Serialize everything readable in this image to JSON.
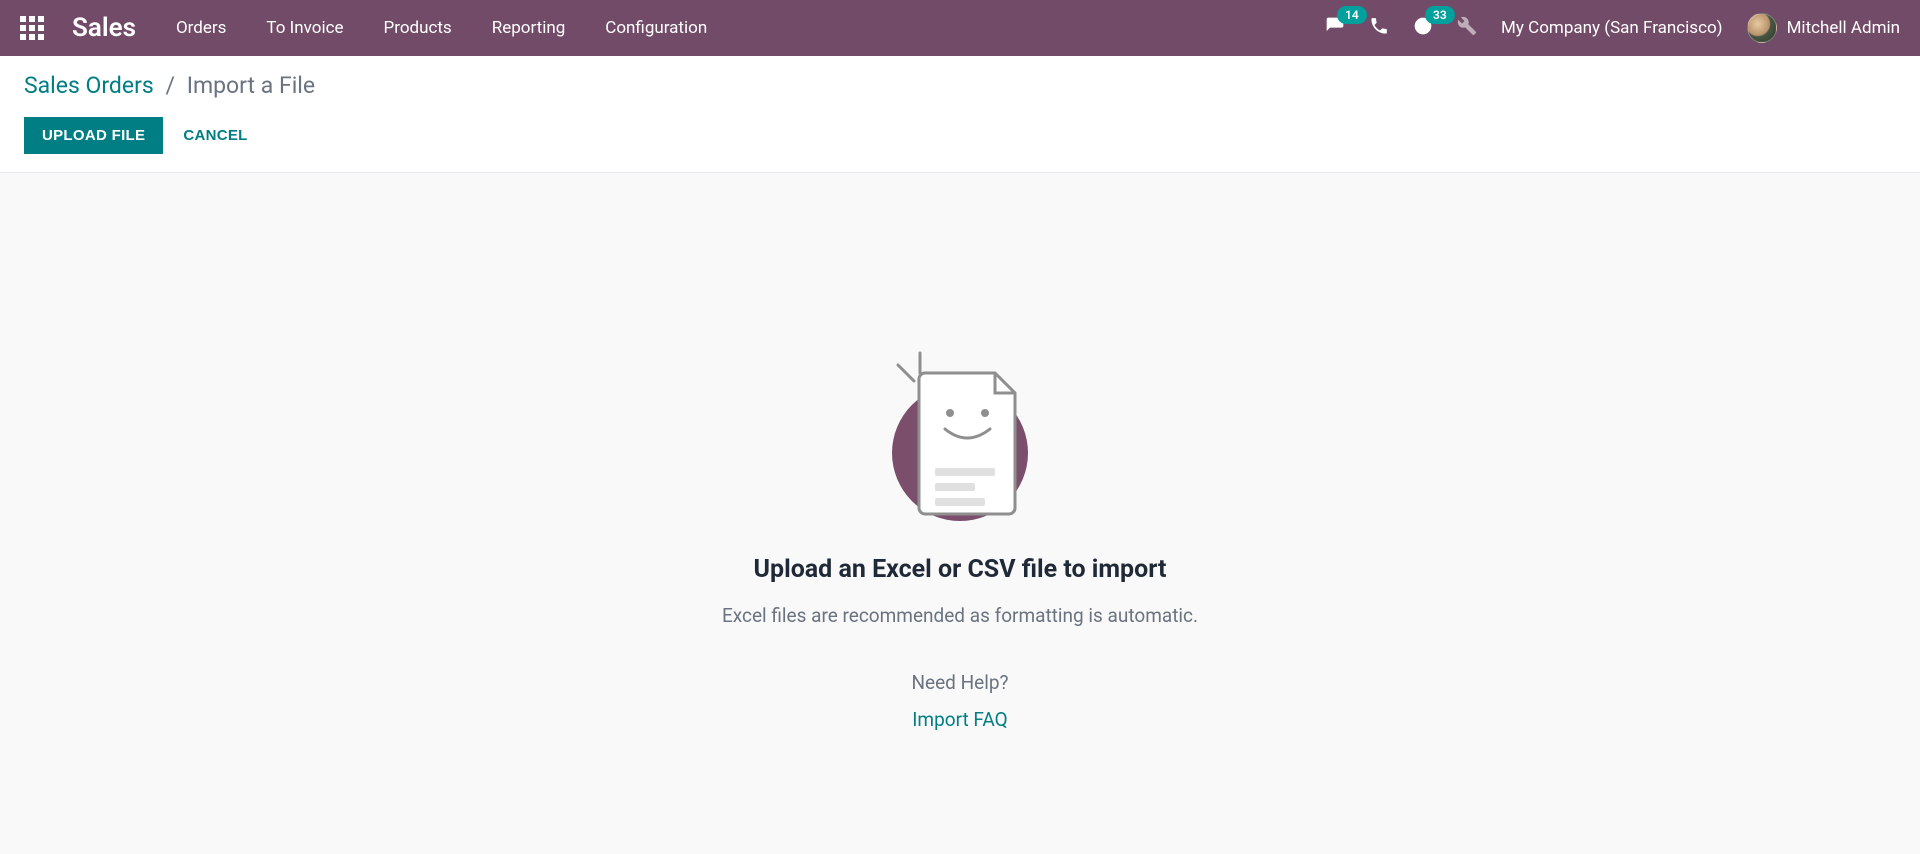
{
  "navbar": {
    "brand": "Sales",
    "menu": [
      "Orders",
      "To Invoice",
      "Products",
      "Reporting",
      "Configuration"
    ],
    "messages_badge": "14",
    "activities_badge": "33",
    "company": "My Company (San Francisco)",
    "user_name": "Mitchell Admin"
  },
  "breadcrumb": {
    "parent": "Sales Orders",
    "separator": "/",
    "current": "Import a File"
  },
  "buttons": {
    "upload": "Upload File",
    "cancel": "Cancel"
  },
  "empty": {
    "title": "Upload an Excel or CSV file to import",
    "subtitle": "Excel files are recommended as formatting is automatic.",
    "help": "Need Help?",
    "faq": "Import FAQ"
  }
}
